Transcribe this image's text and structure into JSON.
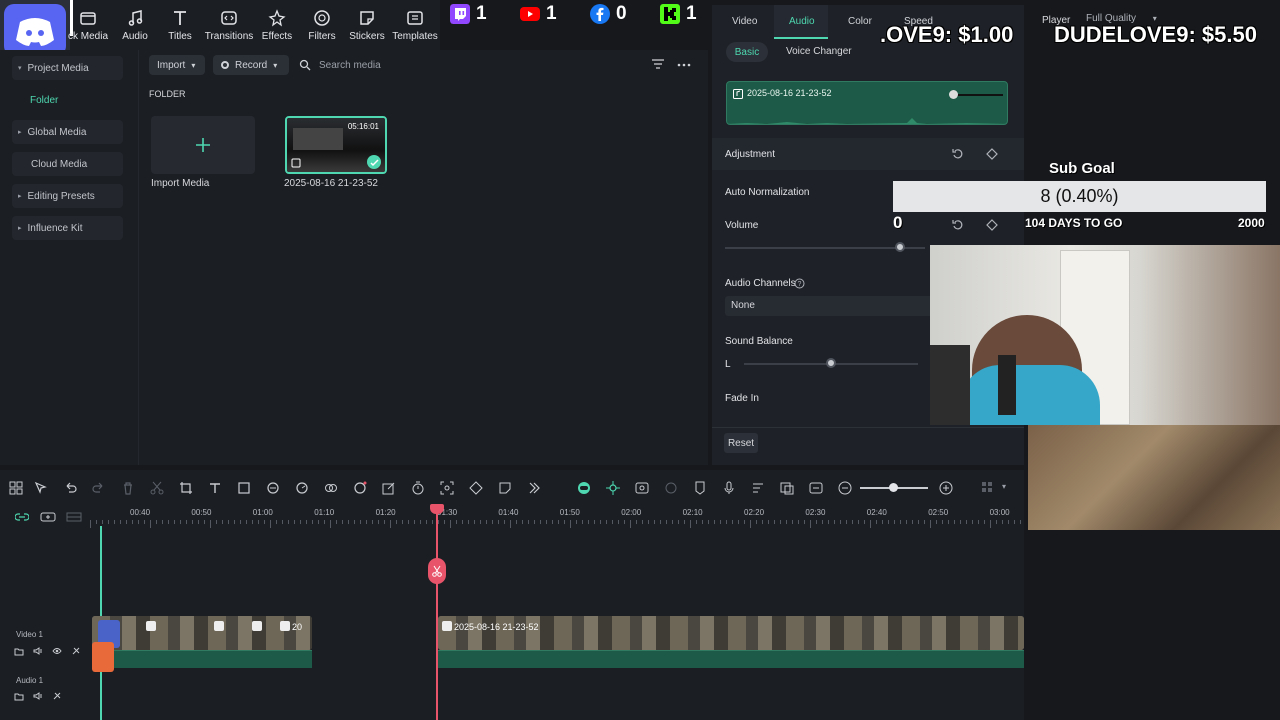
{
  "toolbar": {
    "tabs": [
      {
        "label": "ck Media",
        "icon": "stock-media-icon"
      },
      {
        "label": "Audio",
        "icon": "music-note-icon"
      },
      {
        "label": "Titles",
        "icon": "text-t-icon"
      },
      {
        "label": "Transitions",
        "icon": "transitions-icon"
      },
      {
        "label": "Effects",
        "icon": "effects-icon"
      },
      {
        "label": "Filters",
        "icon": "filters-icon"
      },
      {
        "label": "Stickers",
        "icon": "stickers-icon"
      },
      {
        "label": "Templates",
        "icon": "templates-icon"
      }
    ]
  },
  "stream": {
    "twitch_count": "1",
    "youtube_count": "1",
    "facebook_count": "0",
    "kick_count": "1",
    "tip1": ".OVE9: $1.00",
    "tip2": "DUDELOVE9: $5.50",
    "sub_goal_title": "Sub Goal",
    "sub_goal_value": "8 (0.40%)",
    "sub_goal_fraction": 0.004,
    "days_left": "104 DAYS TO GO",
    "goal_target": "2000",
    "goal_start": "0",
    "colors": {
      "twitch": "#9146ff",
      "youtube": "#ff0000",
      "facebook": "#1877f2",
      "kick": "#53fc18",
      "tip_amount": "#53fc18"
    }
  },
  "sidebar": {
    "items": [
      {
        "label": "Project Media",
        "arrow": "▾"
      },
      {
        "label": "Folder",
        "arrow": ""
      },
      {
        "label": "Global Media",
        "arrow": "▸"
      },
      {
        "label": "Cloud Media",
        "arrow": ""
      },
      {
        "label": "Editing Presets",
        "arrow": "▸"
      },
      {
        "label": "Influence Kit",
        "arrow": "▸"
      }
    ]
  },
  "media": {
    "import_label": "Import",
    "record_label": "Record",
    "search_placeholder": "Search media",
    "folder_heading": "FOLDER",
    "import_card_label": "Import Media",
    "clip_name": "2025-08-16 21-23-52",
    "clip_duration": "05:16:01"
  },
  "audio_panel": {
    "tabs": [
      "Video",
      "Audio",
      "Color",
      "Speed"
    ],
    "subtabs": [
      "Basic",
      "Voice Changer"
    ],
    "track_name": "2025-08-16 21-23-52",
    "adjustment": "Adjustment",
    "auto_normalization": "Auto Normalization",
    "volume": "Volume",
    "audio_channels": "Audio Channels",
    "channels_value": "None",
    "sound_balance": "Sound Balance",
    "balance_left": "L",
    "fade_in": "Fade In",
    "reset": "Reset",
    "accent": "#4ed7b0"
  },
  "player": {
    "label": "Player",
    "quality": "Full Quality"
  },
  "timeline": {
    "ruler": [
      "00:40",
      "00:50",
      "01:00",
      "01:10",
      "01:20",
      "01:30",
      "01:40",
      "01:50",
      "02:00",
      "02:10",
      "02:20",
      "02:30",
      "02:40",
      "02:50",
      "03:00"
    ],
    "video_track": "Video 1",
    "audio_track": "Audio 1",
    "clip_short": "20",
    "clip_long": "2025-08-16 21-23-52",
    "playhead_color": "#e8556a"
  }
}
